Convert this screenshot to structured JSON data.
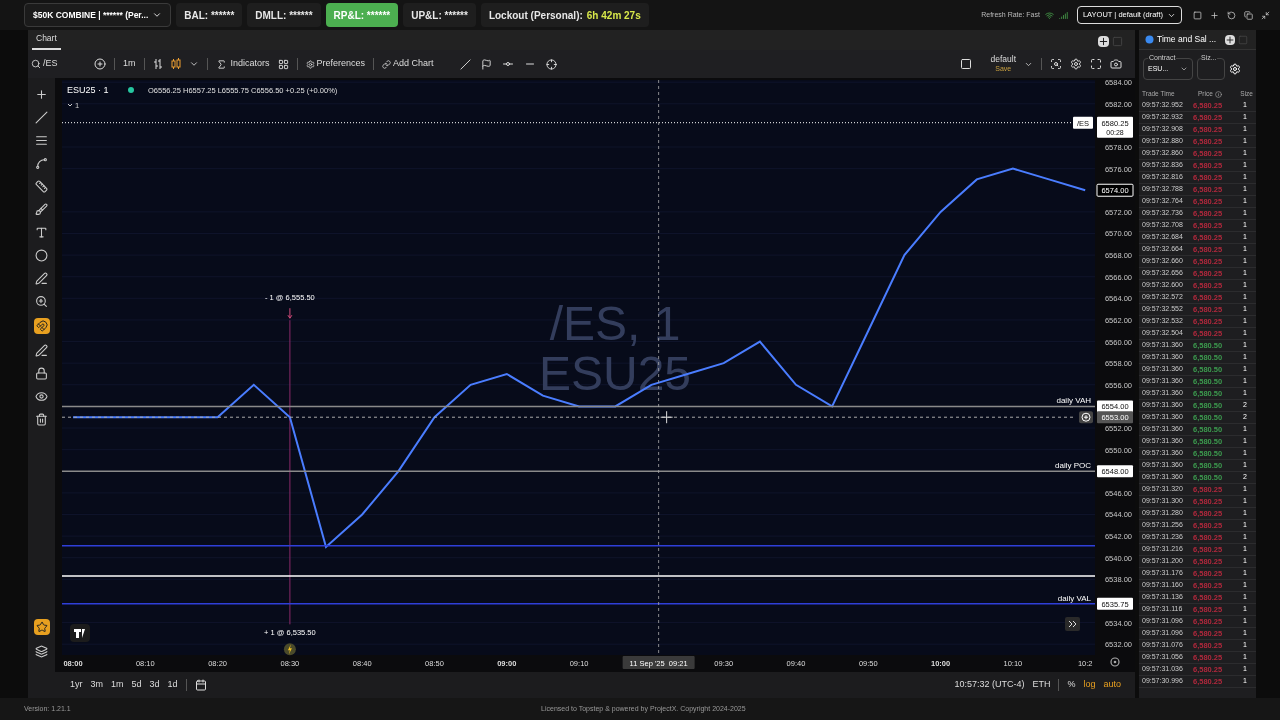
{
  "top_bar": {
    "account": "$50K COMBINE | ****** (Per...",
    "stats": [
      {
        "label": "BAL: ******",
        "selected": false
      },
      {
        "label": "DMLL: ******",
        "selected": false
      },
      {
        "label": "RP&L: ******",
        "selected": true
      },
      {
        "label": "UP&L: ******",
        "selected": false
      }
    ],
    "lockout": {
      "label": "Lockout (Personal):",
      "value": "6h 42m 27s"
    },
    "refresh_rate": "Refresh Rate: Fast",
    "layout": "LAYOUT | default (draft)"
  },
  "chart_panel": {
    "tab": "Chart",
    "toolbar": {
      "symbol": "/ES",
      "interval": "1m",
      "indicators": "Indicators",
      "preferences": "Preferences",
      "add_chart": "Add Chart",
      "template": "default",
      "template_action": "Save"
    },
    "legend": {
      "symbol": "ESU25 · 1",
      "ohlc": "O6556.25 H6557.25 L6555.75 C6556.50 +0.25 (+0.00%)",
      "count": "1"
    },
    "watermark": [
      "/ES, 1",
      "ESU25"
    ],
    "chart_data": {
      "type": "line",
      "categories": [
        "08:00",
        null,
        "08:10",
        null,
        "08:20",
        null,
        "08:30",
        null,
        "08:40",
        null,
        "08:50",
        null,
        "09:00",
        null,
        "09:10",
        null,
        null,
        null,
        "09:30",
        null,
        "09:40",
        null,
        "09:50",
        null,
        "10:00",
        null,
        "10:10",
        null,
        "10:2"
      ],
      "series": [
        {
          "color": "#4a7dff",
          "values": [
            6553,
            6553,
            6553,
            6553,
            6553,
            6556,
            6553,
            6541,
            6544,
            6548,
            6553,
            6556,
            6557,
            6555,
            6554,
            6554,
            6556,
            6557,
            6558,
            6560,
            6556,
            6554,
            6561,
            6568,
            6572,
            6575,
            6576,
            6575,
            6574
          ]
        }
      ],
      "ylim": [
        6531,
        6584.2
      ],
      "grid": true,
      "ref_lines": [
        {
          "axis": "y",
          "value": 6554,
          "color": "#8a8a8a"
        },
        {
          "axis": "y",
          "value": 6548,
          "color": "#8a8a8a"
        },
        {
          "axis": "y",
          "value": 6541.1,
          "color": "#2f3fd8"
        },
        {
          "axis": "y",
          "value": 6538.3,
          "color": "#ffffff"
        },
        {
          "axis": "y",
          "value": 6535.75,
          "color": "#2f3fd8"
        },
        {
          "axis": "y",
          "value": 6553,
          "color": "#aaaaaa"
        },
        {
          "axis": "y",
          "value": 6580.25,
          "color": "#ffffff"
        }
      ],
      "yticks": [
        {
          "value": 6584,
          "label": "6584.00"
        },
        {
          "value": 6582,
          "label": "6582.00"
        },
        {
          "value": 6578,
          "label": "6578.00"
        },
        {
          "value": 6576,
          "label": "6576.00"
        },
        {
          "value": 6572,
          "label": "6572.00"
        },
        {
          "value": 6570,
          "label": "6570.00"
        },
        {
          "value": 6568,
          "label": "6568.00"
        },
        {
          "value": 6566,
          "label": "6566.00"
        },
        {
          "value": 6564,
          "label": "6564.00"
        },
        {
          "value": 6562,
          "label": "6562.00"
        },
        {
          "value": 6560,
          "label": "6560.00"
        },
        {
          "value": 6558,
          "label": "6558.00"
        },
        {
          "value": 6556,
          "label": "6556.00"
        },
        {
          "value": 6552,
          "label": "6552.00"
        },
        {
          "value": 6550,
          "label": "6550.00"
        },
        {
          "value": 6546,
          "label": "6546.00"
        },
        {
          "value": 6544,
          "label": "6544.00"
        },
        {
          "value": 6542,
          "label": "6542.00"
        },
        {
          "value": 6540,
          "label": "6540.00"
        },
        {
          "value": 6538,
          "label": "6538.00"
        },
        {
          "value": 6534,
          "label": "6534.00"
        },
        {
          "value": 6532,
          "label": "6532.00"
        }
      ]
    },
    "last_price": {
      "symbol": "/ES",
      "price": "6580.25",
      "countdown": "00:28"
    },
    "marker_price": "6574.00",
    "levels": [
      {
        "label": "daily VAH",
        "price": "6554.00"
      },
      {
        "label": "daily POC",
        "price": "6548.00"
      },
      {
        "label": "daily VAL",
        "price": "6535.75"
      }
    ],
    "crosshair": {
      "price": "6553.00",
      "time": "11 Sep '25  09:21"
    },
    "orders": [
      {
        "kind": "sell",
        "label": "- 1 @ 6,555.50"
      },
      {
        "kind": "buy",
        "label": "+ 1 @ 6,535.50"
      }
    ],
    "ranges": [
      "1yr",
      "3m",
      "1m",
      "5d",
      "3d",
      "1d"
    ],
    "clock": "10:57:32 (UTC-4)",
    "session": "ETH",
    "scale_options": [
      {
        "label": "%",
        "selected": false
      },
      {
        "label": "log",
        "selected": true
      },
      {
        "label": "auto",
        "selected": true
      }
    ]
  },
  "time_and_sales": {
    "tab": "Time and Sal ...",
    "contract_label": "Contract",
    "contract": "ESU...",
    "size_label": "Siz...",
    "columns": [
      "Trade Time",
      "Price",
      "Size"
    ],
    "rows": [
      {
        "time": "09:57:32.952",
        "price": "6,580.25",
        "size": "1",
        "color": "#b0283c"
      },
      {
        "time": "09:57:32.932",
        "price": "6,580.25",
        "size": "1",
        "color": "#b0283c"
      },
      {
        "time": "09:57:32.908",
        "price": "6,580.25",
        "size": "1",
        "color": "#b0283c"
      },
      {
        "time": "09:57:32.880",
        "price": "6,580.25",
        "size": "1",
        "color": "#b0283c"
      },
      {
        "time": "09:57:32.860",
        "price": "6,580.25",
        "size": "1",
        "color": "#b0283c"
      },
      {
        "time": "09:57:32.836",
        "price": "6,580.25",
        "size": "1",
        "color": "#b0283c"
      },
      {
        "time": "09:57:32.816",
        "price": "6,580.25",
        "size": "1",
        "color": "#b0283c"
      },
      {
        "time": "09:57:32.788",
        "price": "6,580.25",
        "size": "1",
        "color": "#b0283c"
      },
      {
        "time": "09:57:32.764",
        "price": "6,580.25",
        "size": "1",
        "color": "#b0283c"
      },
      {
        "time": "09:57:32.736",
        "price": "6,580.25",
        "size": "1",
        "color": "#b0283c"
      },
      {
        "time": "09:57:32.708",
        "price": "6,580.25",
        "size": "1",
        "color": "#b0283c"
      },
      {
        "time": "09:57:32.684",
        "price": "6,580.25",
        "size": "1",
        "color": "#b0283c"
      },
      {
        "time": "09:57:32.664",
        "price": "6,580.25",
        "size": "1",
        "color": "#b0283c"
      },
      {
        "time": "09:57:32.660",
        "price": "6,580.25",
        "size": "1",
        "color": "#b0283c"
      },
      {
        "time": "09:57:32.656",
        "price": "6,580.25",
        "size": "1",
        "color": "#b0283c"
      },
      {
        "time": "09:57:32.600",
        "price": "6,580.25",
        "size": "1",
        "color": "#b0283c"
      },
      {
        "time": "09:57:32.572",
        "price": "6,580.25",
        "size": "1",
        "color": "#b0283c"
      },
      {
        "time": "09:57:32.552",
        "price": "6,580.25",
        "size": "1",
        "color": "#b0283c"
      },
      {
        "time": "09:57:32.532",
        "price": "6,580.25",
        "size": "1",
        "color": "#b0283c"
      },
      {
        "time": "09:57:32.504",
        "price": "6,580.25",
        "size": "1",
        "color": "#b0283c"
      },
      {
        "time": "09:57:31.360",
        "price": "6,580.50",
        "size": "1",
        "color": "#3c9a4e"
      },
      {
        "time": "09:57:31.360",
        "price": "6,580.50",
        "size": "1",
        "color": "#3c9a4e"
      },
      {
        "time": "09:57:31.360",
        "price": "6,580.50",
        "size": "1",
        "color": "#3c9a4e"
      },
      {
        "time": "09:57:31.360",
        "price": "6,580.50",
        "size": "1",
        "color": "#3c9a4e"
      },
      {
        "time": "09:57:31.360",
        "price": "6,580.50",
        "size": "1",
        "color": "#3c9a4e"
      },
      {
        "time": "09:57:31.360",
        "price": "6,580.50",
        "size": "2",
        "color": "#3c9a4e"
      },
      {
        "time": "09:57:31.360",
        "price": "6,580.50",
        "size": "2",
        "color": "#3c9a4e"
      },
      {
        "time": "09:57:31.360",
        "price": "6,580.50",
        "size": "1",
        "color": "#3c9a4e"
      },
      {
        "time": "09:57:31.360",
        "price": "6,580.50",
        "size": "1",
        "color": "#3c9a4e"
      },
      {
        "time": "09:57:31.360",
        "price": "6,580.50",
        "size": "1",
        "color": "#3c9a4e"
      },
      {
        "time": "09:57:31.360",
        "price": "6,580.50",
        "size": "1",
        "color": "#3c9a4e"
      },
      {
        "time": "09:57:31.360",
        "price": "6,580.50",
        "size": "2",
        "color": "#3c9a4e"
      },
      {
        "time": "09:57:31.320",
        "price": "6,580.25",
        "size": "1",
        "color": "#b0283c"
      },
      {
        "time": "09:57:31.300",
        "price": "6,580.25",
        "size": "1",
        "color": "#b0283c"
      },
      {
        "time": "09:57:31.280",
        "price": "6,580.25",
        "size": "1",
        "color": "#b0283c"
      },
      {
        "time": "09:57:31.256",
        "price": "6,580.25",
        "size": "1",
        "color": "#b0283c"
      },
      {
        "time": "09:57:31.236",
        "price": "6,580.25",
        "size": "1",
        "color": "#b0283c"
      },
      {
        "time": "09:57:31.216",
        "price": "6,580.25",
        "size": "1",
        "color": "#b0283c"
      },
      {
        "time": "09:57:31.200",
        "price": "6,580.25",
        "size": "1",
        "color": "#b0283c"
      },
      {
        "time": "09:57:31.176",
        "price": "6,580.25",
        "size": "1",
        "color": "#b0283c"
      },
      {
        "time": "09:57:31.160",
        "price": "6,580.25",
        "size": "1",
        "color": "#b0283c"
      },
      {
        "time": "09:57:31.136",
        "price": "6,580.25",
        "size": "1",
        "color": "#b0283c"
      },
      {
        "time": "09:57:31.116",
        "price": "6,580.25",
        "size": "1",
        "color": "#b0283c"
      },
      {
        "time": "09:57:31.096",
        "price": "6,580.25",
        "size": "1",
        "color": "#b0283c"
      },
      {
        "time": "09:57:31.096",
        "price": "6,580.25",
        "size": "1",
        "color": "#b0283c"
      },
      {
        "time": "09:57:31.076",
        "price": "6,580.25",
        "size": "1",
        "color": "#b0283c"
      },
      {
        "time": "09:57:31.056",
        "price": "6,580.25",
        "size": "1",
        "color": "#b0283c"
      },
      {
        "time": "09:57:31.036",
        "price": "6,580.25",
        "size": "1",
        "color": "#b0283c"
      },
      {
        "time": "09:57:30.996",
        "price": "6,580.25",
        "size": "1",
        "color": "#b0283c"
      }
    ]
  },
  "footer": {
    "version": "Version: 1.21.1",
    "license": "Licensed to Topstep & powered by ProjectX. Copyright 2024-2025"
  }
}
